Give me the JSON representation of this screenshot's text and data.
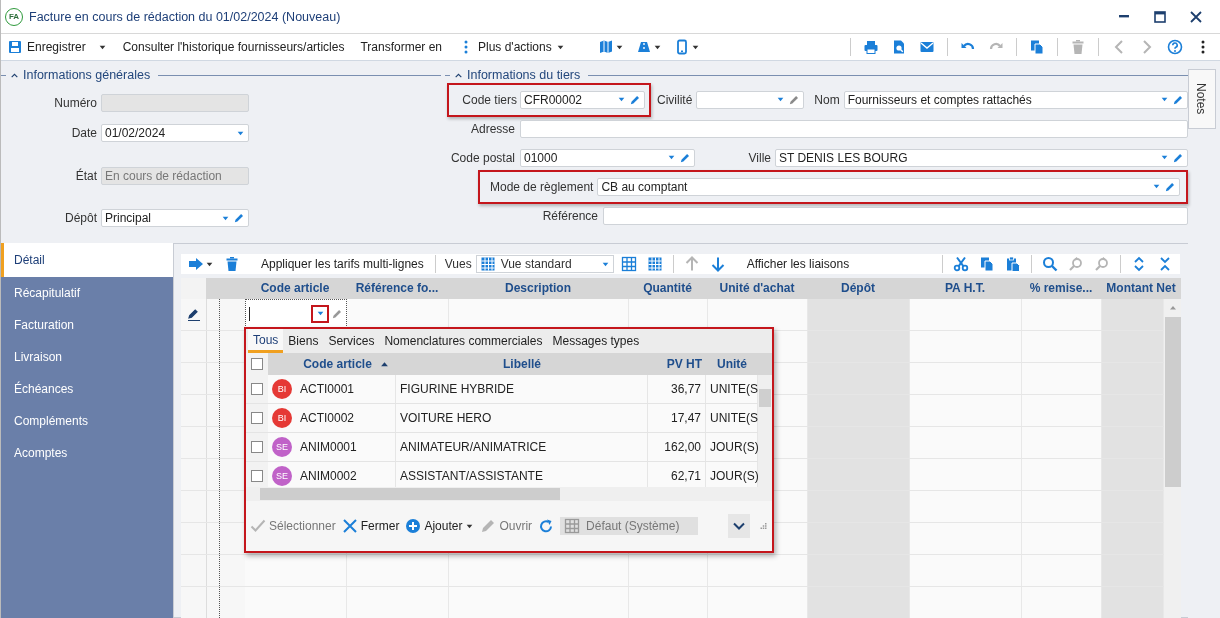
{
  "window": {
    "badge": "FA",
    "title": "Facture en cours de rédaction du 01/02/2024 (Nouveau)"
  },
  "toolbar": {
    "actions": [
      {
        "kind": "save",
        "label": "Enregistrer",
        "dropdown": true
      },
      {
        "kind": "text",
        "label": "Consulter l'historique fournisseurs/articles",
        "dropdown": false
      },
      {
        "kind": "text",
        "label": "Transformer en",
        "dropdown": false
      },
      {
        "kind": "more",
        "label": "Plus d'actions",
        "dropdown": true
      }
    ],
    "icons_left": [
      {
        "kind": "map",
        "dropdown": true,
        "disabled": false
      },
      {
        "kind": "road",
        "dropdown": true,
        "disabled": false
      },
      {
        "kind": "phone",
        "dropdown": true,
        "disabled": false
      }
    ],
    "icons_right": [
      {
        "kind": "separator"
      },
      {
        "kind": "print",
        "disabled": false
      },
      {
        "kind": "preview",
        "disabled": false
      },
      {
        "kind": "mail",
        "disabled": false
      },
      {
        "kind": "separator"
      },
      {
        "kind": "undo",
        "disabled": false
      },
      {
        "kind": "redo",
        "disabled": true
      },
      {
        "kind": "separator"
      },
      {
        "kind": "copy",
        "disabled": false
      },
      {
        "kind": "separator"
      },
      {
        "kind": "trash",
        "disabled": true
      },
      {
        "kind": "separator"
      },
      {
        "kind": "prev",
        "disabled": true
      },
      {
        "kind": "next",
        "disabled": true
      },
      {
        "kind": "help",
        "disabled": false
      },
      {
        "kind": "kebab",
        "disabled": false
      }
    ]
  },
  "general": {
    "title": "Informations générales",
    "fields": [
      {
        "label": "Numéro",
        "kind": "readonly"
      },
      {
        "label": "Date",
        "kind": "date",
        "value": "01/02/2024"
      },
      {
        "label": "État",
        "kind": "readonly",
        "value": "En cours de rédaction"
      },
      {
        "label": "Dépôt",
        "kind": "combo",
        "value": "Principal",
        "edit_disabled": false
      }
    ]
  },
  "tiers": {
    "title": "Informations du tiers",
    "rows": [
      [
        {
          "label": "Code tiers",
          "kind": "combo",
          "value": "CFR00002",
          "edit_disabled": false,
          "highlighted": true
        },
        {
          "label": "Civilité",
          "kind": "combo",
          "edit_disabled": true,
          "highlighted": false
        },
        {
          "label": "Nom",
          "kind": "combo",
          "value": "Fournisseurs et comptes rattachés",
          "edit_disabled": false,
          "highlighted": false
        }
      ],
      [
        {
          "label": "Adresse",
          "kind": "text",
          "highlighted": false
        }
      ],
      [
        {
          "label": "Code postal",
          "kind": "combo",
          "value": "01000",
          "edit_disabled": false,
          "highlighted": false
        },
        {
          "label": "Ville",
          "kind": "combo",
          "value": "ST DENIS LES BOURG",
          "edit_disabled": false,
          "highlighted": false
        }
      ],
      [
        {
          "label": "Mode de règlement",
          "kind": "combo",
          "value": "CB au comptant",
          "edit_disabled": false,
          "highlighted": true
        }
      ],
      [
        {
          "label": "Référence",
          "kind": "text",
          "highlighted": false
        }
      ]
    ]
  },
  "notes_tab": {
    "label": "Notes"
  },
  "sidebar": {
    "items": [
      {
        "label": "Détail",
        "selected": true
      },
      {
        "label": "Récapitulatif",
        "selected": false
      },
      {
        "label": "Facturation",
        "selected": false
      },
      {
        "label": "Livraison",
        "selected": false
      },
      {
        "label": "Échéances",
        "selected": false
      },
      {
        "label": "Compléments",
        "selected": false
      },
      {
        "label": "Acomptes",
        "selected": false
      }
    ]
  },
  "detail_toolbar": {
    "items": [
      {
        "kind": "arrow",
        "dropdown": true,
        "disabled": false
      },
      {
        "kind": "trash",
        "disabled": false
      },
      {
        "kind": "text",
        "label": "Appliquer les tarifs multi-lignes"
      },
      {
        "kind": "separator"
      },
      {
        "kind": "label",
        "label": "Vues"
      },
      {
        "kind": "combo",
        "label": "Vue standard"
      },
      {
        "kind": "grid",
        "disabled": false
      },
      {
        "kind": "grid2",
        "disabled": false
      },
      {
        "kind": "separator"
      },
      {
        "kind": "up",
        "disabled": true
      },
      {
        "kind": "down",
        "disabled": false
      },
      {
        "kind": "text",
        "label": "Afficher les liaisons"
      },
      {
        "kind": "spacer"
      },
      {
        "kind": "separator"
      },
      {
        "kind": "cut",
        "disabled": false
      },
      {
        "kind": "copy",
        "disabled": false
      },
      {
        "kind": "paste",
        "disabled": false
      },
      {
        "kind": "separator"
      },
      {
        "kind": "search",
        "disabled": false
      },
      {
        "kind": "search-prev",
        "disabled": true
      },
      {
        "kind": "search-next",
        "disabled": true
      },
      {
        "kind": "separator"
      },
      {
        "kind": "expand",
        "disabled": false
      },
      {
        "kind": "collapse",
        "disabled": false
      }
    ]
  },
  "grid": {
    "columns": [
      {
        "label": "Code article",
        "readonly": false
      },
      {
        "label": "Référence fo...",
        "readonly": false
      },
      {
        "label": "Description",
        "readonly": false
      },
      {
        "label": "Quantité",
        "readonly": false
      },
      {
        "label": "Unité d'achat",
        "readonly": false
      },
      {
        "label": "Dépôt",
        "readonly": true
      },
      {
        "label": "PA H.T.",
        "readonly": false
      },
      {
        "label": "% remise...",
        "readonly": false
      },
      {
        "label": "Montant Net",
        "readonly": true
      }
    ],
    "editor": {
      "highlighted": true
    }
  },
  "popup": {
    "tabs": [
      {
        "label": "Tous",
        "selected": true
      },
      {
        "label": "Biens",
        "selected": false
      },
      {
        "label": "Services",
        "selected": false
      },
      {
        "label": "Nomenclatures commerciales",
        "selected": false
      },
      {
        "label": "Messages types",
        "selected": false
      }
    ],
    "columns": [
      {
        "label": "Code article",
        "sorted": true
      },
      {
        "label": "Libellé",
        "sorted": false
      },
      {
        "label": "PV HT",
        "sorted": false
      },
      {
        "label": "Unité",
        "sorted": false
      }
    ],
    "rows": [
      {
        "checked": false,
        "type": "BI",
        "color": "#e53935",
        "code": "ACTI0001",
        "label": "FIGURINE HYBRIDE",
        "price": "36,77",
        "unit": "UNITE(S"
      },
      {
        "checked": false,
        "type": "BI",
        "color": "#e53935",
        "code": "ACTI0002",
        "label": "VOITURE HERO",
        "price": "17,47",
        "unit": "UNITE(S"
      },
      {
        "checked": false,
        "type": "SE",
        "color": "#c062c8",
        "code": "ANIM0001",
        "label": "ANIMATEUR/ANIMATRICE",
        "price": "162,00",
        "unit": "JOUR(S)"
      },
      {
        "checked": false,
        "type": "SE",
        "color": "#c062c8",
        "code": "ANIM0002",
        "label": "ASSISTANT/ASSISTANTE",
        "price": "62,71",
        "unit": "JOUR(S)"
      }
    ],
    "footer": [
      {
        "kind": "check",
        "label": "Sélectionner",
        "disabled": true
      },
      {
        "kind": "close",
        "label": "Fermer",
        "disabled": false
      },
      {
        "kind": "add",
        "label": "Ajouter",
        "disabled": false,
        "dropdown": true
      },
      {
        "kind": "edit",
        "label": "Ouvrir",
        "disabled": true
      },
      {
        "kind": "refresh",
        "disabled": false
      },
      {
        "kind": "layout",
        "label": "Défaut (Système)",
        "disabled": true
      },
      {
        "kind": "chevron"
      }
    ],
    "all_checked": false
  }
}
